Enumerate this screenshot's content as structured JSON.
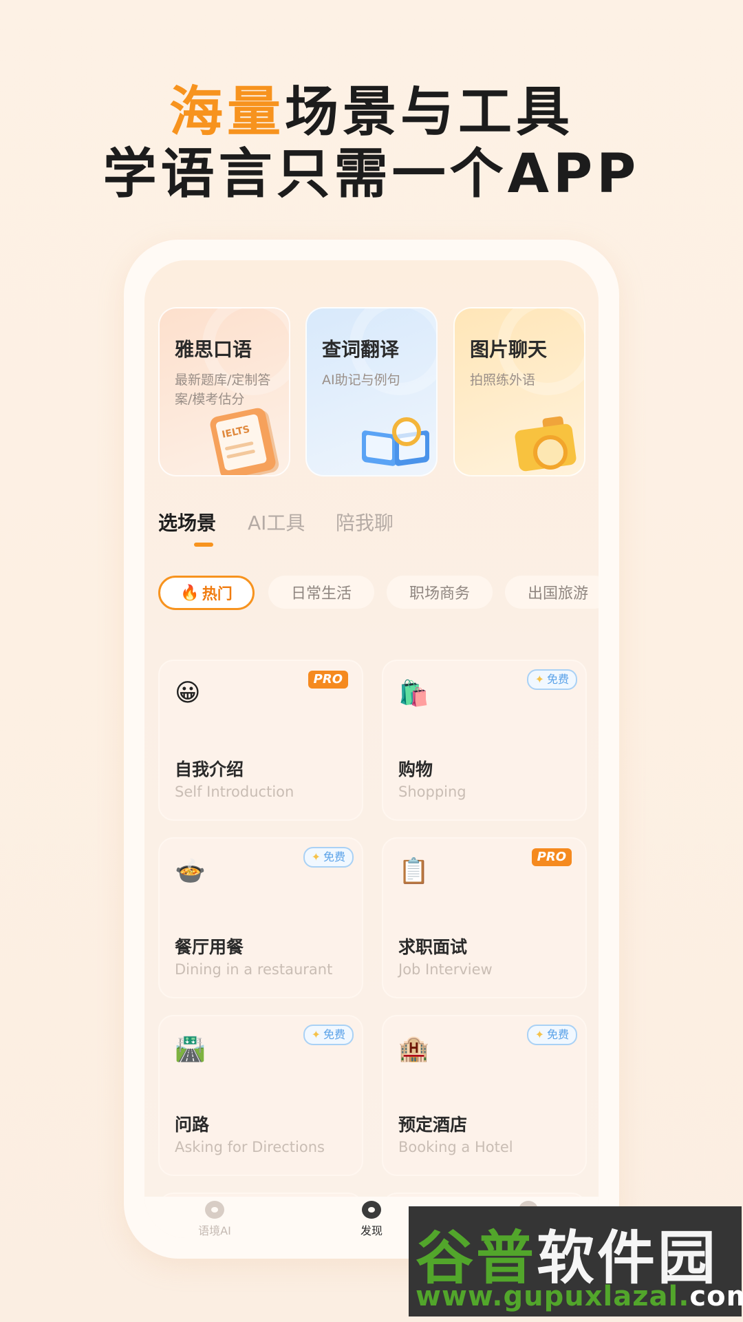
{
  "headline": {
    "accent": "海量",
    "line1_rest": "场景与工具",
    "line2": "学语言只需一个APP"
  },
  "features": [
    {
      "title": "雅思口语",
      "subtitle": "最新题库/定制答案/模考估分",
      "illustration_text": "IELTS"
    },
    {
      "title": "查词翻译",
      "subtitle": "AI助记与例句"
    },
    {
      "title": "图片聊天",
      "subtitle": "拍照练外语"
    }
  ],
  "tabs": [
    "选场景",
    "AI工具",
    "陪我聊"
  ],
  "chips": [
    {
      "label": "热门",
      "icon": "flame-icon"
    },
    {
      "label": "日常生活"
    },
    {
      "label": "职场商务"
    },
    {
      "label": "出国旅游"
    }
  ],
  "cards": [
    {
      "emoji": "😀",
      "title": "自我介绍",
      "subtitle": "Self Introduction",
      "badge": "PRO"
    },
    {
      "emoji": "🛍️",
      "title": "购物",
      "subtitle": "Shopping",
      "badge": "免费"
    },
    {
      "emoji": "🍲",
      "title": "餐厅用餐",
      "subtitle": "Dining in a restaurant",
      "badge": "免费"
    },
    {
      "emoji": "📋",
      "title": "求职面试",
      "subtitle": "Job Interview",
      "badge": "PRO"
    },
    {
      "emoji": "🛣️",
      "title": "问路",
      "subtitle": "Asking for Directions",
      "badge": "免费"
    },
    {
      "emoji": "🏨",
      "title": "预定酒店",
      "subtitle": "Booking a Hotel",
      "badge": "免费"
    }
  ],
  "bottom_nav": [
    {
      "label": "语境AI",
      "icon": "chat-bubble-icon"
    },
    {
      "label": "发现",
      "icon": "eye-icon",
      "active": true
    },
    {
      "label": "",
      "icon": "face-icon"
    }
  ],
  "watermark": {
    "line1_a": "谷普",
    "line1_b": "软件园",
    "line2_a": "www.gupuxlazal.",
    "line2_b": "com"
  },
  "colors": {
    "accent": "#f7931e",
    "pro_badge": "#f58a1f",
    "free_badge": "#5aa2e8"
  }
}
